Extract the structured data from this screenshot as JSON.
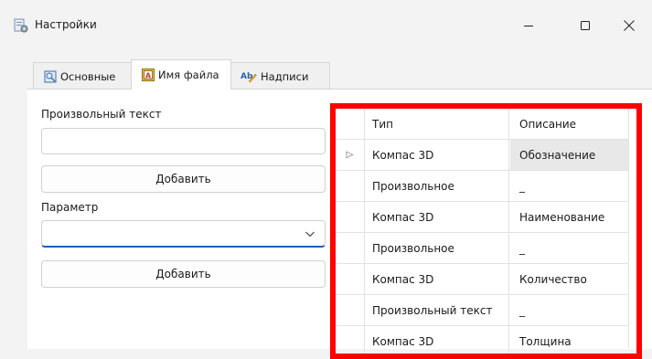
{
  "window": {
    "title": "Настройки",
    "minimize_glyph": "—",
    "maximize_glyph": "☐",
    "close_glyph": "✕"
  },
  "tabs": [
    {
      "label": "Основные",
      "icon": "settings-tab-icon",
      "active": false
    },
    {
      "label": "Имя файла",
      "icon": "file-name-tab-icon",
      "active": true
    },
    {
      "label": "Надписи",
      "icon": "text-label-tab-icon",
      "active": false
    }
  ],
  "form": {
    "custom_text_label": "Произвольный текст",
    "custom_text_value": "",
    "add_button_1": "Добавить",
    "parameter_label": "Параметр",
    "parameter_value": "",
    "add_button_2": "Добавить"
  },
  "grid": {
    "columns": [
      "Тип",
      "Описание"
    ],
    "rows": [
      {
        "type": "Компас 3D",
        "description": "Обозначение",
        "current": true
      },
      {
        "type": "Произвольное",
        "description": "_",
        "current": false
      },
      {
        "type": "Компас 3D",
        "description": "Наименование",
        "current": false
      },
      {
        "type": "Произвольное",
        "description": "_",
        "current": false
      },
      {
        "type": "Компас 3D",
        "description": "Количество",
        "current": false
      },
      {
        "type": "Произвольный текст",
        "description": "_",
        "current": false
      },
      {
        "type": "Компас 3D",
        "description": "Толщина",
        "current": false
      }
    ],
    "current_row_marker": "▷"
  },
  "colors": {
    "highlight_border": "#ff0000",
    "combo_underline": "#1660b8"
  }
}
